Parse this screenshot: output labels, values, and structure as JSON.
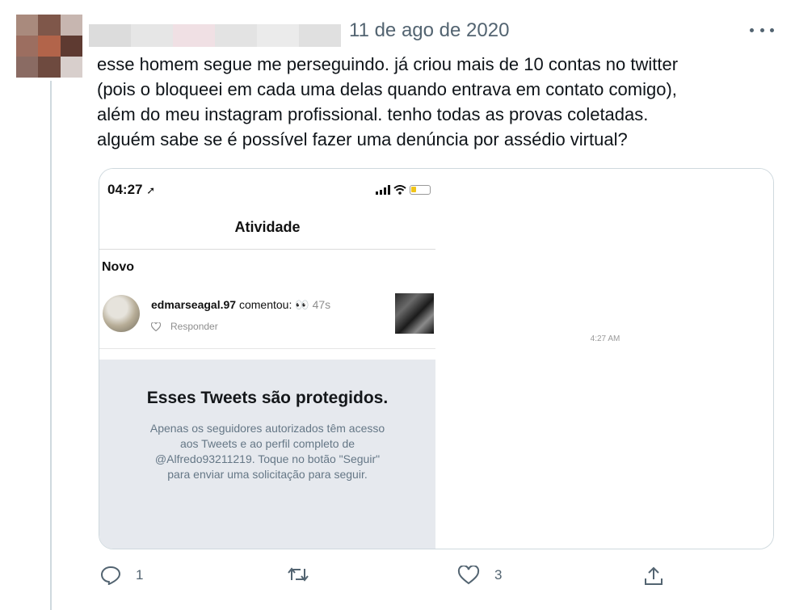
{
  "tweet": {
    "date": "11 de ago de 2020",
    "text_lines": [
      "esse homem segue me perseguindo. já criou mais de 10 contas no twitter",
      "(pois o bloqueei em cada uma delas quando entrava em contato comigo),",
      "além do meu instagram profissional. tenho todas as provas coletadas.",
      "alguém sabe se é possível fazer uma denúncia por assédio virtual?"
    ],
    "more_icon": "more-horizontal-icon"
  },
  "media": {
    "left": {
      "status_time": "04:27",
      "screen_title": "Atividade",
      "section_label": "Novo",
      "notification": {
        "username": "edmarseagal.97",
        "action": "comentou:",
        "emoji": "👀",
        "time": "47s",
        "reply_label": "Responder"
      },
      "protected": {
        "title": "Esses Tweets são protegidos.",
        "body_lines": [
          "Apenas os seguidores autorizados têm acesso",
          "aos Tweets e ao perfil completo de",
          "@Alfredo93211219. Toque no botão \"Seguir\"",
          "para enviar uma solicitação para seguir."
        ]
      }
    },
    "right": {
      "time": "4:27 AM"
    }
  },
  "actions": {
    "reply_count": "1",
    "retweet_count": "",
    "like_count": "3"
  },
  "colors": {
    "text_primary": "#0f1419",
    "text_secondary": "#536471",
    "border": "#cfd9de",
    "protected_bg": "#e6e9ee"
  }
}
